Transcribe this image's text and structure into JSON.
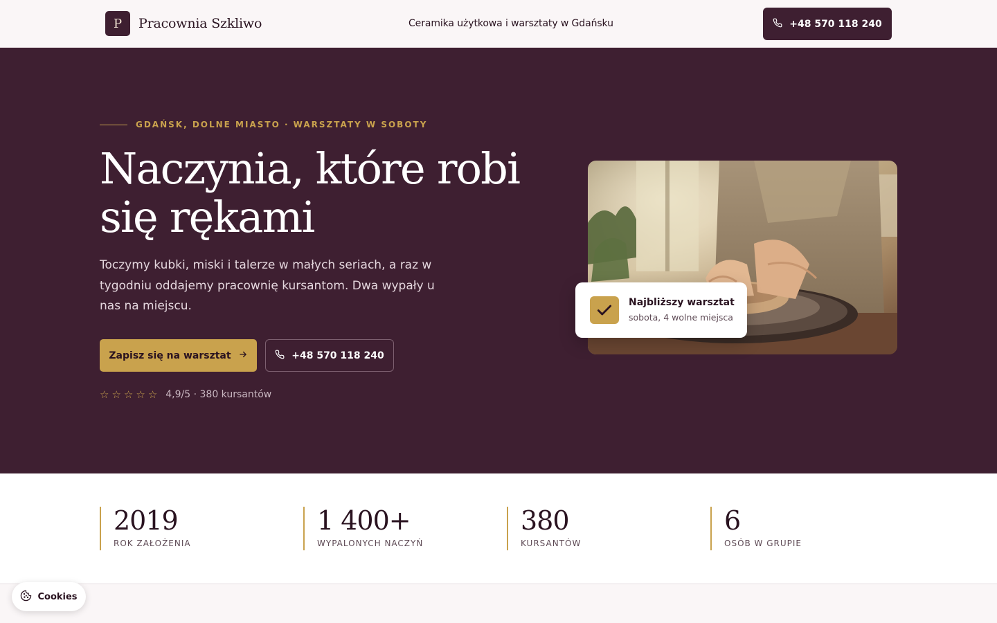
{
  "header": {
    "logo_letter": "P",
    "brand": "Pracownia Szkliwo",
    "tagline": "Ceramika użytkowa i warsztaty w Gdańsku",
    "phone": "+48 570 118 240"
  },
  "hero": {
    "eyebrow": "GDAŃSK, DOLNE MIASTO · WARSZTATY W SOBOTY",
    "title": "Naczynia, które robi się rękami",
    "description": "Toczymy kubki, miski i talerze w małych seriach, a raz w tygodniu oddajemy pracownię kursantom. Dwa wypały u nas na miejscu.",
    "cta_primary": "Zapisz się na warsztat",
    "cta_secondary": "+48 570 118 240",
    "rating_text": "4,9/5 · 380 kursantów",
    "stars": 5,
    "workshop_card": {
      "title": "Najbliższy warsztat",
      "subtitle": "sobota, 4 wolne miejsca"
    }
  },
  "stats": [
    {
      "value": "2019",
      "label": "ROK ZAŁOŻENIA"
    },
    {
      "value": "1 400+",
      "label": "WYPALONYCH NACZYŃ"
    },
    {
      "value": "380",
      "label": "KURSANTÓW"
    },
    {
      "value": "6",
      "label": "OSÓB W GRUPIE"
    }
  ],
  "cookies": {
    "label": "Cookies"
  },
  "colors": {
    "plum": "#3e1f31",
    "gold": "#c9a24d",
    "ink": "#2a1320",
    "cream": "#faf6f7"
  },
  "icons": [
    "phone-icon",
    "arrow-right-icon",
    "star-icon",
    "check-icon",
    "cookie-icon"
  ]
}
